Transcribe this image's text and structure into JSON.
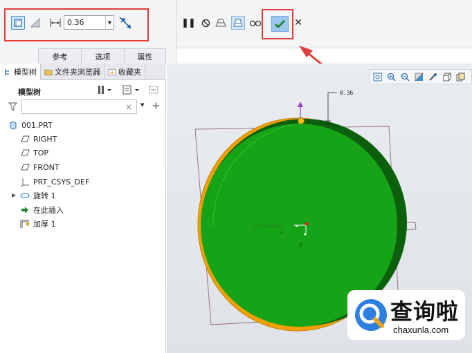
{
  "dashboard": {
    "thickness_value": "0.36",
    "tabs": [
      "参考",
      "选项",
      "属性"
    ]
  },
  "panel": {
    "tabs": [
      "模型树",
      "文件夹浏览器",
      "收藏夹"
    ],
    "tree_title": "模型树",
    "search_placeholder": "",
    "clear_symbol": "×"
  },
  "tree": {
    "items": [
      {
        "label": "001.PRT",
        "icon": "part-icon"
      },
      {
        "label": "RIGHT",
        "icon": "datum-plane-icon"
      },
      {
        "label": "TOP",
        "icon": "datum-plane-icon"
      },
      {
        "label": "FRONT",
        "icon": "datum-plane-icon"
      },
      {
        "label": "PRT_CSYS_DEF",
        "icon": "csys-icon"
      },
      {
        "label": "旋转 1",
        "icon": "revolve-icon"
      },
      {
        "label": "在此插入",
        "icon": "insert-arrow-icon"
      },
      {
        "label": "加厚 1",
        "icon": "thicken-icon"
      }
    ]
  },
  "graphics": {
    "dimension_label": "0.36",
    "csys_labels": [
      "Y",
      "Z"
    ],
    "plane_label": "PRT_CSYS_DEF"
  },
  "watermark": {
    "cn": "查询啦",
    "en": "chaxunla.com"
  },
  "colors": {
    "surface_green": "#16a317",
    "rim_orange": "#f2a007",
    "highlight_red": "#e23b3b",
    "active_blue": "#9cc6ee",
    "watermark_blue": "#2d7fe0"
  }
}
